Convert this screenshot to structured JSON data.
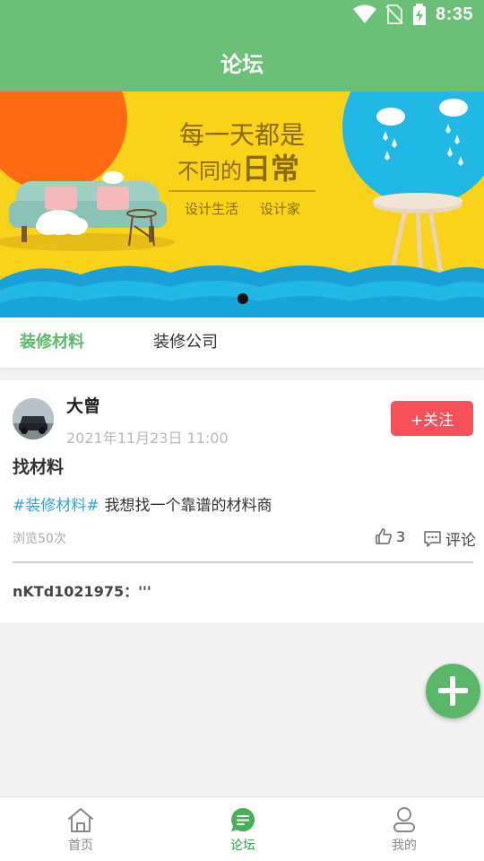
{
  "status_bar": {
    "time": "8:35"
  },
  "header": {
    "title": "论坛"
  },
  "banner": {
    "headline_line1": "每一天都是",
    "headline_line2_prefix": "不同的",
    "headline_line2_emph": "日常",
    "sub1": "设计生活",
    "sub2": "设计家"
  },
  "tabs": [
    {
      "label": "装修材料",
      "active": true
    },
    {
      "label": "装修公司",
      "active": false
    }
  ],
  "post": {
    "username": "大曾",
    "datetime": "2021年11月23日 11:00",
    "follow_label": "+关注",
    "title": "找材料",
    "tag": "#装修材料#",
    "body": "我想找一个靠谱的材料商",
    "views": "浏览50次",
    "like_count": "3",
    "comment_label": "评论",
    "reply": "nKTd1021975：'''"
  },
  "bottom_nav": [
    {
      "label": "首页",
      "icon": "home-icon",
      "active": false
    },
    {
      "label": "论坛",
      "icon": "forum-icon",
      "active": true
    },
    {
      "label": "我的",
      "icon": "profile-icon",
      "active": false
    }
  ],
  "colors": {
    "primary": "#6cbf77",
    "active_tab": "#5cb86a",
    "follow_button": "#f4515a",
    "tag": "#2fa6d9",
    "fab": "#5ab76a",
    "banner_bg": "#f9d21a"
  }
}
